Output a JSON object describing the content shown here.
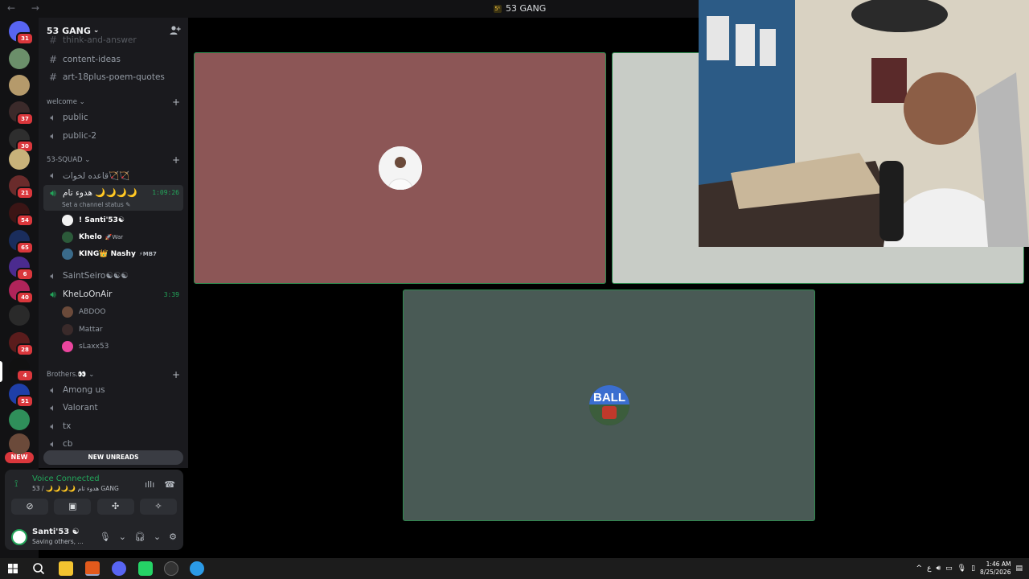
{
  "window": {
    "title": "53 GANG",
    "nav": "← →"
  },
  "servers": [
    {
      "badge": "31",
      "color": "#5865f2"
    },
    {
      "badge": "",
      "color": "#6b8f6a"
    },
    {
      "badge": "",
      "color": "#b59a6b"
    },
    {
      "badge": "37",
      "color": "#3b2a2a"
    },
    {
      "badge": "30",
      "color": "#2e2e2e"
    },
    {
      "badge": "",
      "color": "#c8b27a"
    },
    {
      "badge": "21",
      "color": "#6a2b2b"
    },
    {
      "badge": "54",
      "color": "#3b1515"
    },
    {
      "badge": "65",
      "color": "#1a2d5c"
    },
    {
      "badge": "6",
      "color": "#4b2b8f"
    },
    {
      "badge": "40",
      "color": "#b0245a"
    },
    {
      "badge": "",
      "color": "#2a2a2a"
    },
    {
      "badge": "28",
      "color": "#5a1c1c"
    },
    {
      "badge": "4",
      "color": "#111"
    },
    {
      "badge": "51",
      "color": "#1f3fa8"
    },
    {
      "badge": "",
      "color": "#2f8f5a"
    },
    {
      "badge": "",
      "color": "#6b4a3a"
    }
  ],
  "new_pill": "NEW",
  "guild": {
    "name": "53 GANG"
  },
  "channels": {
    "partial_top": "think-and-answer",
    "text": [
      {
        "name": "content-ideas"
      },
      {
        "name": "art-18plus-poem-quotes"
      }
    ],
    "cat_welcome": "welcome",
    "welcome": [
      {
        "name": "public"
      },
      {
        "name": "public-2"
      }
    ],
    "cat_squad": "53-SQUAD",
    "squad_first": "قاعده لخوات🏹🏹",
    "active_voice": {
      "name": "هدوء تام 🌙🌙🌙🌙",
      "time": "1:09:26",
      "status": "Set a channel status ✎"
    },
    "active_members": [
      {
        "name": "! Santi'53☯",
        "tag": "",
        "color": "#f2f2f2"
      },
      {
        "name": "Khelo",
        "tag": "🚀War",
        "color": "#2c5a3a"
      },
      {
        "name": "KING👑 Nashy",
        "tag": "⚡MB7",
        "color": "#3a6a8a"
      }
    ],
    "saint": "SaintSeiro☯☯☯",
    "khelo_air": {
      "name": "KheLoOnAir",
      "time": "3:39"
    },
    "air_members": [
      {
        "name": "ABDOO",
        "color": "#6b4a3a"
      },
      {
        "name": "Mattar",
        "color": "#3a2a2a"
      },
      {
        "name": "sLaxx53",
        "color": "#eb459e"
      }
    ],
    "cat_brothers": "Brothers.👀",
    "brothers": [
      {
        "name": "Among us"
      },
      {
        "name": "Valorant"
      },
      {
        "name": "tx"
      },
      {
        "name": "cb"
      }
    ],
    "new_unreads": "NEW UNREADS"
  },
  "voice_panel": {
    "title": "Voice Connected",
    "subtitle": "53 / 🌙🌙🌙🌙 هدوء تام GANG"
  },
  "user": {
    "name": "Santi'53 ☯",
    "status": "Saving others, ..."
  },
  "tiles": [
    {
      "bg": "#8c5656"
    },
    {
      "bg": "#c8ccc6"
    },
    {
      "bg": "#495a55"
    }
  ],
  "avatar_ball_text": "BALL",
  "clock": {
    "time": "1:46 AM",
    "date": "8/25/2026"
  },
  "tray": {
    "lang": "ع"
  }
}
